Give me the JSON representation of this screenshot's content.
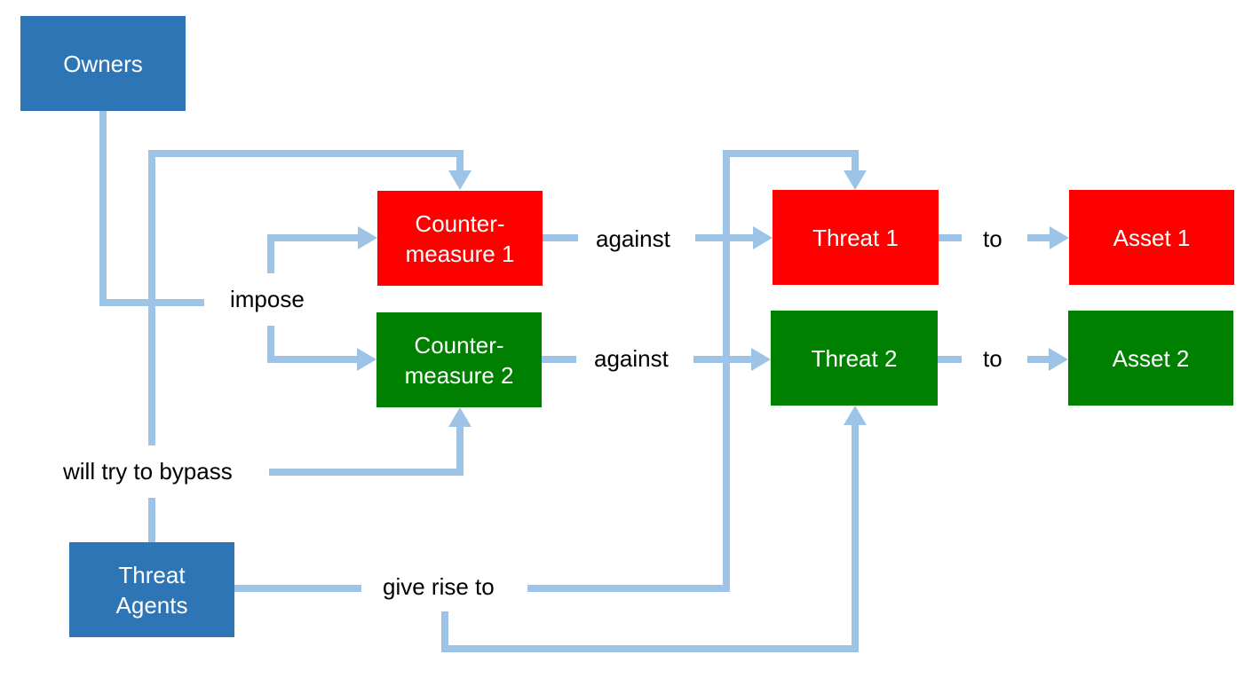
{
  "colors": {
    "owner_box": "#2e75b6",
    "red_box": "#ff0000",
    "green_box": "#008000",
    "connector": "#9dc3e6",
    "text_on_box": "#ffffff",
    "label_text": "#000000"
  },
  "nodes": {
    "owners": {
      "label": "Owners"
    },
    "countermeasure1": {
      "line1": "Counter-",
      "line2": "measure 1"
    },
    "countermeasure2": {
      "line1": "Counter-",
      "line2": "measure 2"
    },
    "threat1": {
      "label": "Threat 1"
    },
    "threat2": {
      "label": "Threat 2"
    },
    "asset1": {
      "label": "Asset 1"
    },
    "asset2": {
      "label": "Asset 2"
    },
    "threat_agents": {
      "line1": "Threat",
      "line2": "Agents"
    }
  },
  "edge_labels": {
    "impose": "impose",
    "against1": "against",
    "against2": "against",
    "to1": "to",
    "to2": "to",
    "will_try_to_bypass": "will try to bypass",
    "give_rise_to": "give rise to"
  }
}
